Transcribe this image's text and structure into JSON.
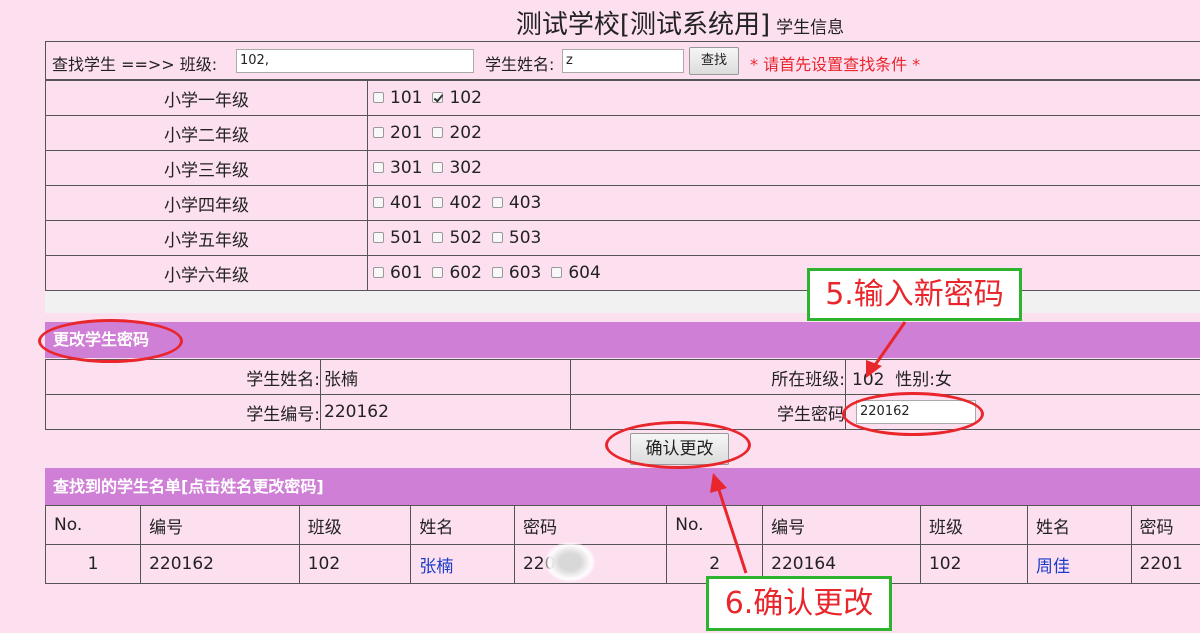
{
  "header": {
    "title": "测试学校[测试系统用]",
    "subtitle": "学生信息"
  },
  "search": {
    "find_label": "查找学生 ==>> 班级:",
    "class_value": "102,",
    "name_label": "学生姓名:",
    "name_value": "z",
    "search_button": "查找",
    "notice": "* 请首先设置查找条件 *"
  },
  "grades": [
    {
      "name": "小学一年级",
      "classes": [
        {
          "label": "101",
          "checked": false
        },
        {
          "label": "102",
          "checked": true
        }
      ]
    },
    {
      "name": "小学二年级",
      "classes": [
        {
          "label": "201",
          "checked": false
        },
        {
          "label": "202",
          "checked": false
        }
      ]
    },
    {
      "name": "小学三年级",
      "classes": [
        {
          "label": "301",
          "checked": false
        },
        {
          "label": "302",
          "checked": false
        }
      ]
    },
    {
      "name": "小学四年级",
      "classes": [
        {
          "label": "401",
          "checked": false
        },
        {
          "label": "402",
          "checked": false
        },
        {
          "label": "403",
          "checked": false
        }
      ]
    },
    {
      "name": "小学五年级",
      "classes": [
        {
          "label": "501",
          "checked": false
        },
        {
          "label": "502",
          "checked": false
        },
        {
          "label": "503",
          "checked": false
        }
      ]
    },
    {
      "name": "小学六年级",
      "classes": [
        {
          "label": "601",
          "checked": false
        },
        {
          "label": "602",
          "checked": false
        },
        {
          "label": "603",
          "checked": false
        },
        {
          "label": "604",
          "checked": false
        }
      ]
    }
  ],
  "change_password": {
    "section_title": "更改学生密码",
    "name_label": "学生姓名:",
    "name_value": "张楠",
    "class_label": "所在班级:",
    "class_value": "102",
    "gender": "性别:女",
    "id_label": "学生编号:",
    "id_value": "220162",
    "password_label": "学生密码",
    "password_value": "220162",
    "confirm_button": "确认更改"
  },
  "student_list": {
    "section_title": "查找到的学生名单[点击姓名更改密码]",
    "headers": [
      "No.",
      "编号",
      "班级",
      "姓名",
      "密码",
      "No.",
      "编号",
      "班级",
      "姓名",
      "密码"
    ],
    "rows": [
      [
        "1",
        "220162",
        "102",
        "张楠",
        "220",
        "2",
        "220164",
        "102",
        "周佳",
        "2201"
      ]
    ]
  },
  "annotations": {
    "step5": "5.输入新密码",
    "step6": "6.确认更改"
  },
  "colors": {
    "section_bar": "#cf7fd6",
    "background": "#fde0f0",
    "annotation_red": "#e8262b",
    "annotation_green": "#2db32d",
    "link": "#1a3cc8"
  }
}
